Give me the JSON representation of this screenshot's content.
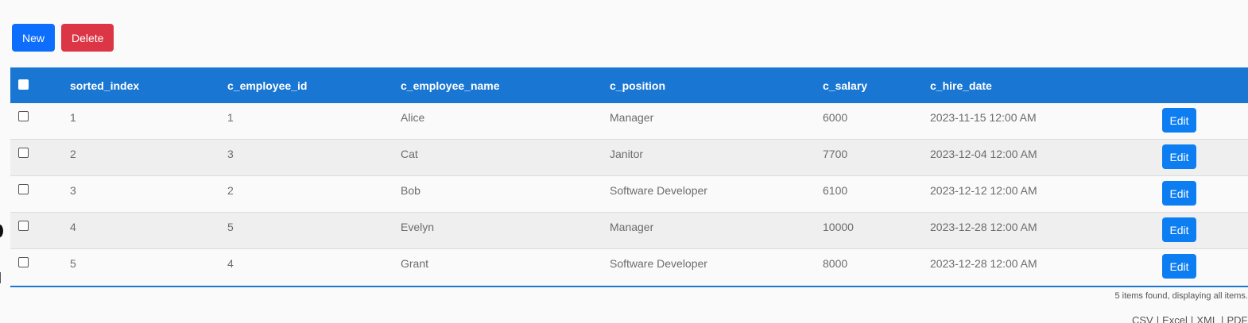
{
  "toolbar": {
    "new_label": "New",
    "delete_label": "Delete"
  },
  "table": {
    "columns": [
      "sorted_index",
      "c_employee_id",
      "c_employee_name",
      "c_position",
      "c_salary",
      "c_hire_date"
    ],
    "rows": [
      {
        "sorted_index": "1",
        "c_employee_id": "1",
        "c_employee_name": "Alice",
        "c_position": "Manager",
        "c_salary": "6000",
        "c_hire_date": "2023-11-15 12:00 AM",
        "action": "Edit"
      },
      {
        "sorted_index": "2",
        "c_employee_id": "3",
        "c_employee_name": "Cat",
        "c_position": "Janitor",
        "c_salary": "7700",
        "c_hire_date": "2023-12-04 12:00 AM",
        "action": "Edit"
      },
      {
        "sorted_index": "3",
        "c_employee_id": "2",
        "c_employee_name": "Bob",
        "c_position": "Software Developer",
        "c_salary": "6100",
        "c_hire_date": "2023-12-12 12:00 AM",
        "action": "Edit"
      },
      {
        "sorted_index": "4",
        "c_employee_id": "5",
        "c_employee_name": "Evelyn",
        "c_position": "Manager",
        "c_salary": "10000",
        "c_hire_date": "2023-12-28 12:00 AM",
        "action": "Edit"
      },
      {
        "sorted_index": "5",
        "c_employee_id": "4",
        "c_employee_name": "Grant",
        "c_position": "Software Developer",
        "c_salary": "8000",
        "c_hire_date": "2023-12-28 12:00 AM",
        "action": "Edit"
      }
    ]
  },
  "footer": {
    "items_found": "5 items found, displaying all items.",
    "exports": [
      "CSV",
      "Excel",
      "XML",
      "PDF"
    ]
  },
  "colors": {
    "header_bg": "#1976d2",
    "new_button": "#0d6efd",
    "delete_button": "#dc3545",
    "edit_button": "#0d7ef2"
  }
}
